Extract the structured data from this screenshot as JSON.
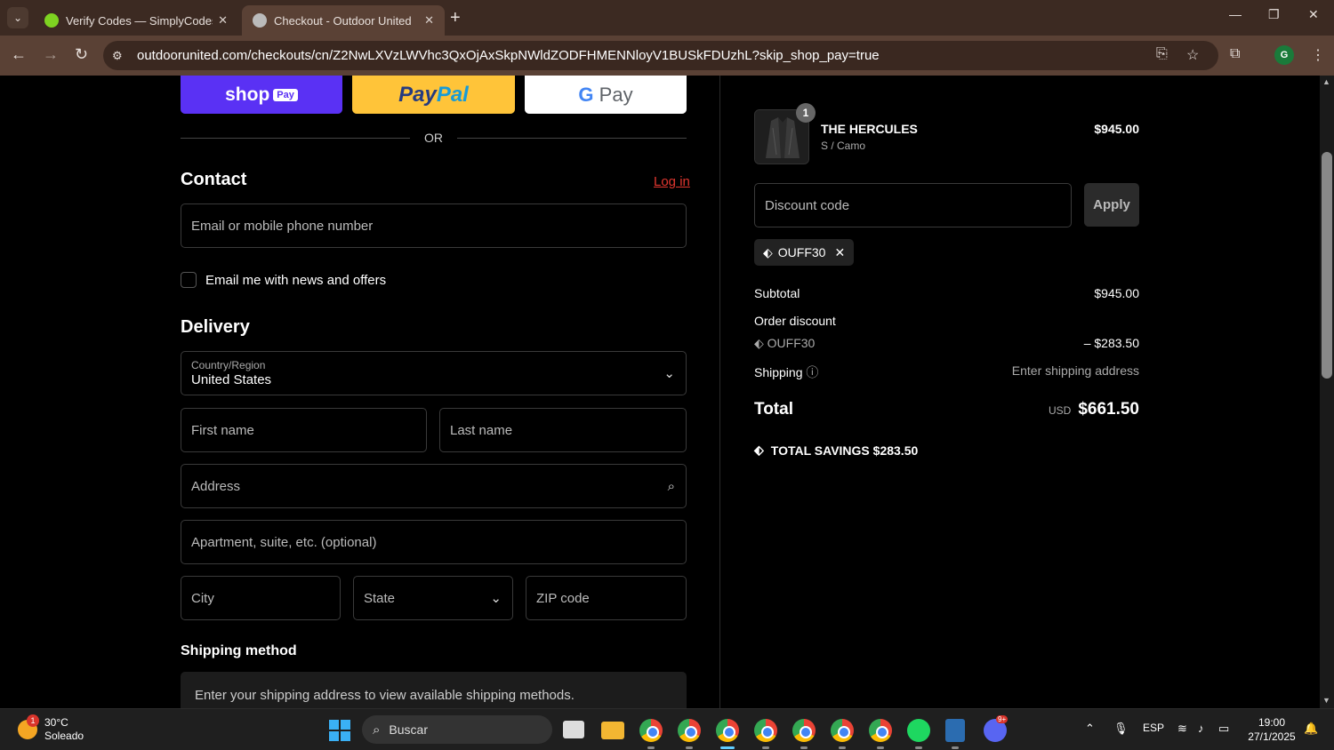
{
  "browser": {
    "tabs": [
      {
        "title": "Verify Codes — SimplyCodes",
        "active": false
      },
      {
        "title": "Checkout - Outdoor United",
        "active": true
      }
    ],
    "url": "outdoorunited.com/checkouts/cn/Z2NwLXVzLWVhc3QxOjAxSkpNWldZODFHMENNloyV1BUSkFDUzhL?skip_shop_pay=true",
    "profile_initial": "G"
  },
  "checkout": {
    "express": {
      "shop_label": "shop",
      "shop_pay_label": "Pay",
      "paypal_a": "Pay",
      "paypal_b": "Pal",
      "gpay_g": "G",
      "gpay_label": "Pay"
    },
    "or_label": "OR",
    "contact": {
      "heading": "Contact",
      "login_link": "Log in",
      "email_placeholder": "Email or mobile phone number",
      "newsletter_label": "Email me with news and offers"
    },
    "delivery": {
      "heading": "Delivery",
      "country_label": "Country/Region",
      "country_value": "United States",
      "first_name": "First name",
      "last_name": "Last name",
      "address": "Address",
      "apartment": "Apartment, suite, etc. (optional)",
      "city": "City",
      "state": "State",
      "zip": "ZIP code"
    },
    "shipping_method": {
      "heading": "Shipping method",
      "message": "Enter your shipping address to view available shipping methods."
    }
  },
  "summary": {
    "item": {
      "quantity": "1",
      "name": "THE HERCULES",
      "variant": "S / Camo",
      "price": "$945.00"
    },
    "discount_placeholder": "Discount code",
    "apply_label": "Apply",
    "applied_code": "OUFF30",
    "subtotal_label": "Subtotal",
    "subtotal_value": "$945.00",
    "order_discount_label": "Order discount",
    "discount_code": "OUFF30",
    "discount_value": "– $283.50",
    "shipping_label": "Shipping",
    "shipping_value": "Enter shipping address",
    "total_label": "Total",
    "total_currency": "USD",
    "total_value": "$661.50",
    "savings_label": "TOTAL SAVINGS",
    "savings_value": "$283.50"
  },
  "taskbar": {
    "weather_temp": "30°C",
    "weather_desc": "Soleado",
    "weather_badge": "1",
    "search_label": "Buscar",
    "language": "ESP",
    "time": "19:00",
    "date": "27/1/2025",
    "discord_badge": "9+"
  }
}
